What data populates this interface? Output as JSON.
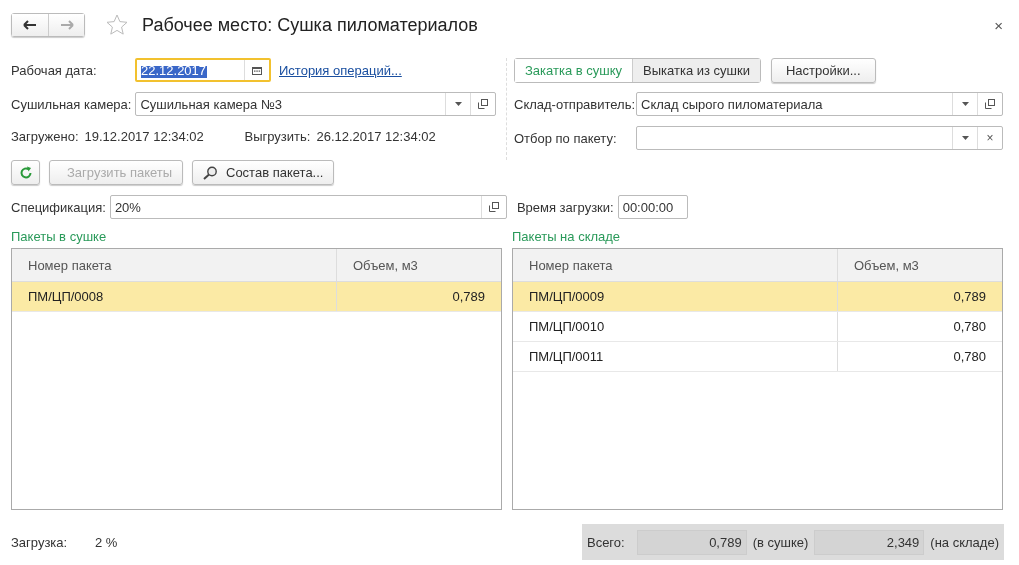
{
  "window": {
    "title": "Рабочее место: Сушка пиломатериалов",
    "close": "×"
  },
  "left_form": {
    "work_date": {
      "label": "Рабочая дата:",
      "value": "22.12.2017",
      "focused": true
    },
    "history_link": "История операций...",
    "chamber": {
      "label": "Сушильная камера:",
      "value": "Сушильная камера №3"
    },
    "loaded": {
      "label": "Загружено:",
      "value": "19.12.2017 12:34:02"
    },
    "unload": {
      "label": "Выгрузить:",
      "value": "26.12.2017 12:34:02"
    }
  },
  "mode_toggle": [
    {
      "label": "Закатка в сушку",
      "selected": true
    },
    {
      "label": "Выкатка из сушки",
      "selected": false
    }
  ],
  "settings_button": "Настройки...",
  "right_form": {
    "sender": {
      "label": "Склад-отправитель:",
      "value": "Склад сырого пиломатериала"
    },
    "package_filter": {
      "label": "Отбор по пакету:",
      "clear": "×"
    }
  },
  "toolbar": [
    {
      "kind": "refresh"
    },
    {
      "kind": "load",
      "label": "Загрузить пакеты",
      "disabled": true
    },
    {
      "kind": "composition",
      "label": "Состав пакета...",
      "disabled": false
    }
  ],
  "specification": {
    "label": "Спецификация:",
    "value": "20%"
  },
  "load_time": {
    "label": "Время загрузки:",
    "value": "00:00:00"
  },
  "tables": [
    {
      "title": "Пакеты в сушке",
      "columns": [
        "Номер пакета",
        "Объем, м3"
      ],
      "rows": [
        {
          "number": "ПМ/ЦП/0008",
          "volume": "0,789",
          "selected": true
        }
      ]
    },
    {
      "title": "Пакеты на складе",
      "columns": [
        "Номер пакета",
        "Объем, м3"
      ],
      "rows": [
        {
          "number": "ПМ/ЦП/0009",
          "volume": "0,789",
          "selected": true
        },
        {
          "number": "ПМ/ЦП/0010",
          "volume": "0,780",
          "selected": false
        },
        {
          "number": "ПМ/ЦП/0011",
          "volume": "0,780",
          "selected": false
        }
      ]
    }
  ],
  "footer": {
    "load_label": "Загрузка:",
    "load_value": "2 %",
    "total_label": "Всего:",
    "in_dryer": "0,789",
    "in_dryer_note": "(в сушке)",
    "in_stock": "2,349",
    "in_stock_note": "(на складе)"
  }
}
